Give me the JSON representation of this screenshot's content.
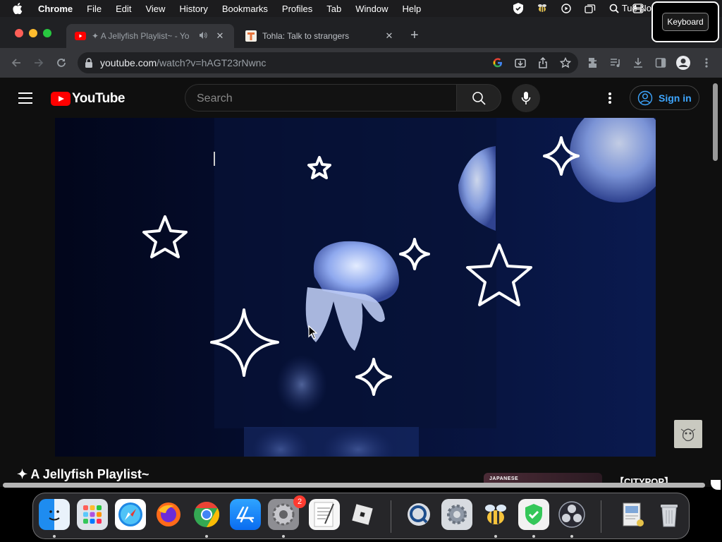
{
  "menubar": {
    "app_name": "Chrome",
    "items": [
      "File",
      "Edit",
      "View",
      "History",
      "Bookmarks",
      "Profiles",
      "Tab",
      "Window",
      "Help"
    ],
    "clock": "Tue No",
    "status_icons": [
      "shield-check-icon",
      "bee-icon",
      "play-circle-icon",
      "windows-icon",
      "search-icon",
      "control-center-icon"
    ]
  },
  "keyboard_popup": {
    "label": "Keyboard"
  },
  "tabs": [
    {
      "title": "✦ A Jellyfish Playlist~ - Yo",
      "active": true,
      "favicon": "youtube-icon",
      "audio": true
    },
    {
      "title": "Tohla: Talk to strangers",
      "active": false,
      "favicon": "tohla-icon"
    }
  ],
  "toolbar": {
    "url_host": "youtube.com",
    "url_path": "/watch?v=hAGT23rNwnc"
  },
  "youtube": {
    "logo_text": "YouTube",
    "search_placeholder": "Search",
    "signin_label": "Sign in",
    "video_title": "✦ A Jellyfish Playlist~",
    "side_video_thumb_text": "JAPANESE",
    "side_video_title": "【CITYPOP】"
  },
  "dock": {
    "apps": [
      {
        "name": "Finder",
        "icon": "finder-icon"
      },
      {
        "name": "Launchpad",
        "icon": "launchpad-icon"
      },
      {
        "name": "Safari",
        "icon": "safari-icon"
      },
      {
        "name": "Firefox",
        "icon": "firefox-icon"
      },
      {
        "name": "Chrome",
        "icon": "chrome-icon"
      },
      {
        "name": "App Store",
        "icon": "app-store-icon"
      },
      {
        "name": "System Preferences",
        "icon": "system-preferences-icon",
        "badge": "2"
      },
      {
        "name": "TextEdit",
        "icon": "textedit-icon"
      },
      {
        "name": "Roblox",
        "icon": "roblox-icon"
      },
      {
        "name": "QuickTime",
        "icon": "quicktime-icon"
      },
      {
        "name": "Settings",
        "icon": "gear-icon"
      },
      {
        "name": "Bee",
        "icon": "bee-icon"
      },
      {
        "name": "Shield",
        "icon": "shield-icon"
      },
      {
        "name": "OBS",
        "icon": "obs-icon"
      },
      {
        "name": "Preview",
        "icon": "preview-icon"
      },
      {
        "name": "Trash",
        "icon": "trash-icon"
      }
    ]
  },
  "colors": {
    "youtube_red": "#ff0000",
    "link_blue": "#3ea6ff",
    "player_bg": "#050b26"
  }
}
